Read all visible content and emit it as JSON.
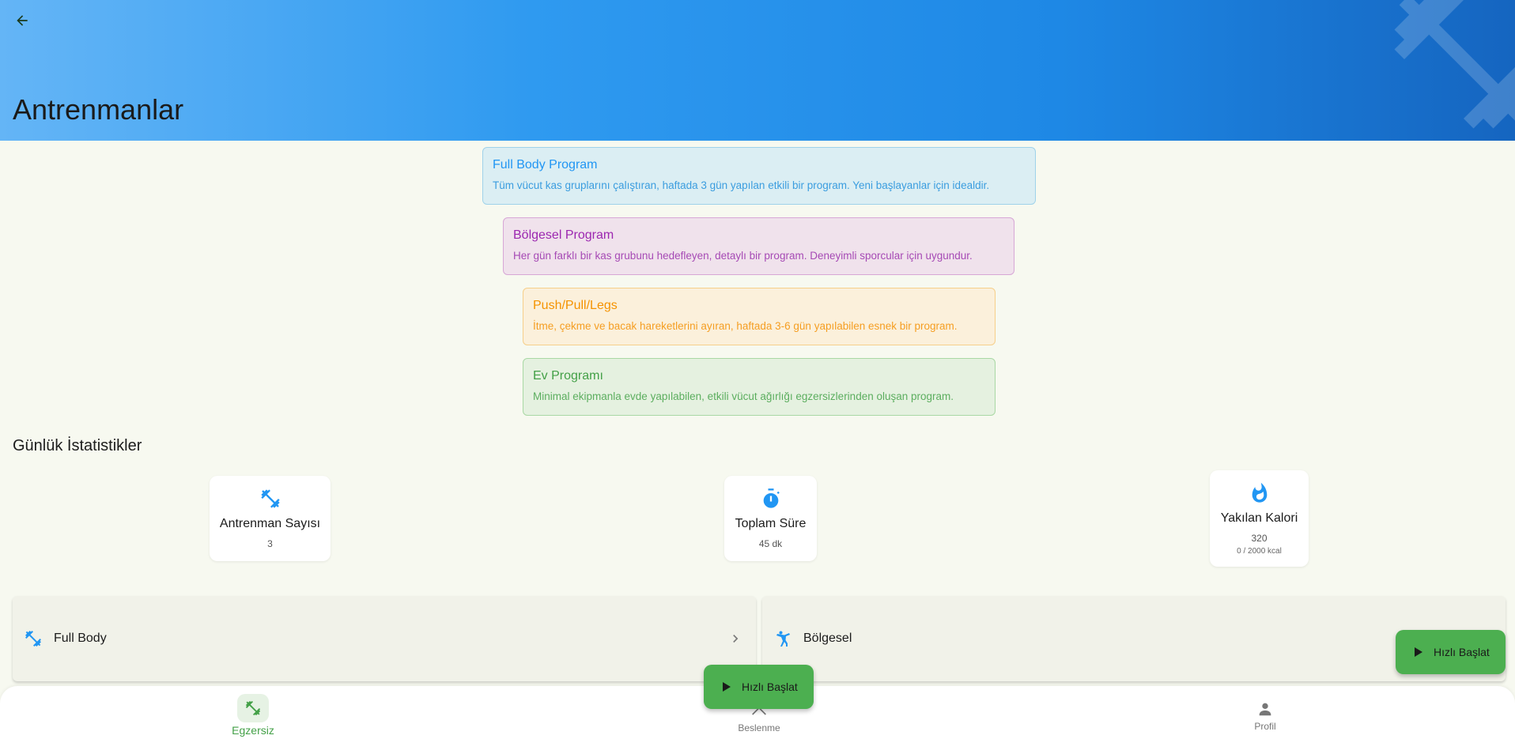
{
  "header": {
    "title": "Antrenmanlar",
    "colors": {
      "gradient_start": "#64b5f6",
      "gradient_end": "#1565c0"
    }
  },
  "programs": [
    {
      "title": "Full Body Program",
      "description": "Tüm vücut kas gruplarını çalıştıran, haftada 3 gün yapılan etkili bir program. Yeni başlayanlar için idealdir.",
      "color": "#2196f3"
    },
    {
      "title": "Bölgesel Program",
      "description": "Her gün farklı bir kas grubunu hedefleyen, detaylı bir program. Deneyimli sporcular için uygundur.",
      "color": "#9c27b0"
    },
    {
      "title": "Push/Pull/Legs",
      "description": "İtme, çekme ve bacak hareketlerini ayıran, haftada 3-6 gün yapılabilen esnek bir program.",
      "color": "#f59300"
    },
    {
      "title": "Ev Programı",
      "description": "Minimal ekipmanla evde yapılabilen, etkili vücut ağırlığı egzersizlerinden oluşan program.",
      "color": "#43a047"
    }
  ],
  "stats": {
    "section_title": "Günlük İstatistikler",
    "items": [
      {
        "title": "Antrenman Sayısı",
        "value": "3",
        "icon": "dumbbell-icon"
      },
      {
        "title": "Toplam Süre",
        "value": "45 dk",
        "icon": "timer-icon"
      },
      {
        "title": "Yakılan Kalori",
        "value": "320",
        "sub": "0 / 2000 kcal",
        "icon": "flame-icon"
      }
    ]
  },
  "categories": [
    {
      "label": "Full Body",
      "icon": "dumbbell-icon"
    },
    {
      "label": "Bölgesel",
      "icon": "gymnastics-icon"
    }
  ],
  "fab": {
    "label": "Hızlı Başlat",
    "accent": "#4caf50"
  },
  "bottom_nav": {
    "items": [
      {
        "label": "Egzersiz",
        "icon": "dumbbell-icon",
        "active": true
      },
      {
        "label": "Beslenme",
        "icon": "chevron-up-icon",
        "active": false
      },
      {
        "label": "Profil",
        "icon": "person-icon",
        "active": false
      }
    ]
  }
}
